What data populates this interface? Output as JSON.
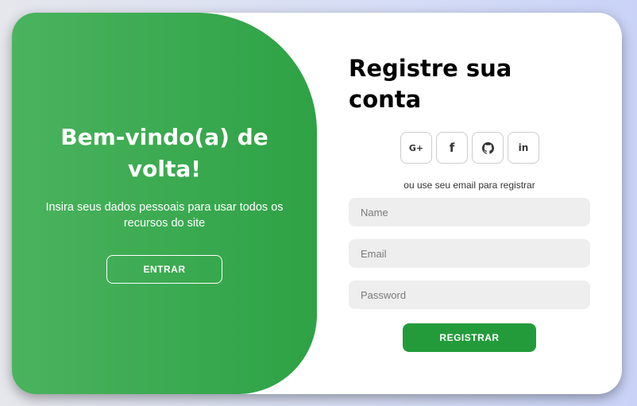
{
  "welcome": {
    "title": "Bem-vindo(a) de volta!",
    "text": "Insira seus dados pessoais para usar todos os recursos do site",
    "button_label": "ENTRAR"
  },
  "signup": {
    "title": "Registre sua conta",
    "social": [
      {
        "icon": "google-plus-icon",
        "glyph": "G+"
      },
      {
        "icon": "facebook-icon",
        "glyph": "f"
      },
      {
        "icon": "github-icon",
        "glyph": ""
      },
      {
        "icon": "linkedin-icon",
        "glyph": "in"
      }
    ],
    "divider_text": "ou use seu email para registrar",
    "fields": {
      "name": {
        "placeholder": "Name",
        "value": ""
      },
      "email": {
        "placeholder": "Email",
        "value": ""
      },
      "password": {
        "placeholder": "Password",
        "value": ""
      }
    },
    "button_label": "REGISTRAR"
  },
  "colors": {
    "accent_green": "#2ea245",
    "button_green": "#249b3b",
    "input_bg": "#eeeeee"
  }
}
